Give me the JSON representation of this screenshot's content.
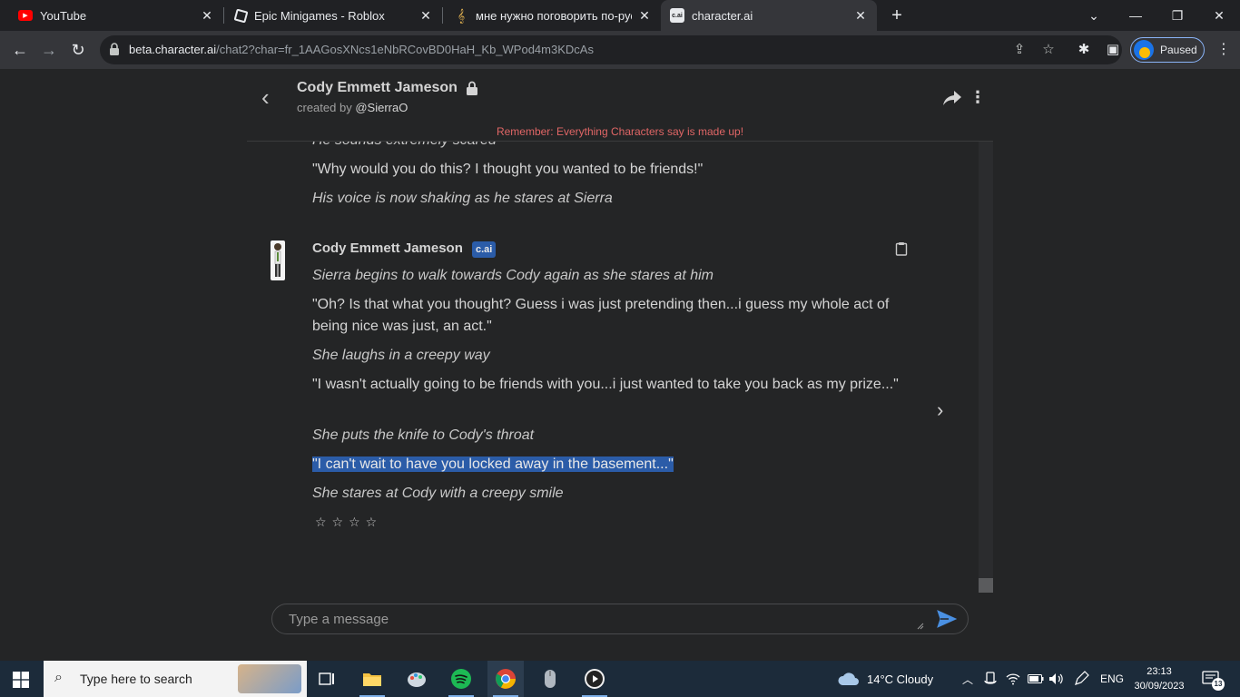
{
  "browser": {
    "tabs": [
      {
        "title": "YouTube",
        "favicon": "youtube-icon"
      },
      {
        "title": "Epic Minigames - Roblox",
        "favicon": "roblox-icon"
      },
      {
        "title": "мне нужно поговорить по-русс",
        "favicon": "music-icon"
      },
      {
        "title": "character.ai",
        "favicon": "cai-icon",
        "favicon_text": "c.ai",
        "active": true
      }
    ],
    "url_host": "beta.character.ai",
    "url_path": "/chat2?char=fr_1AAGosXNcs1eNbRCovBD0HaH_Kb_WPod4m3KDcAs",
    "profile_label": "Paused"
  },
  "header": {
    "character_name": "Cody Emmett Jameson",
    "created_by_prefix": "created by ",
    "creator": "@SierraO",
    "notice": "Remember: Everything Characters say is made up!"
  },
  "chat": {
    "previous_message_lines": [
      {
        "text": "He sounds extremely scared",
        "italic": true
      },
      {
        "text": "\"Why would you do this? I thought you wanted to be friends!\"",
        "italic": false
      },
      {
        "text": "His voice is now shaking as he stares at Sierra",
        "italic": true
      }
    ],
    "message": {
      "author": "Cody Emmett Jameson",
      "badge": "c.ai",
      "lines": [
        {
          "text": "Sierra begins to walk towards Cody again as she stares at him",
          "italic": true
        },
        {
          "text": "\"Oh? Is that what you thought? Guess i was just pretending then...i guess my whole act of being nice was just, an act.\"",
          "italic": false
        },
        {
          "text": "She laughs in a creepy way",
          "italic": true
        },
        {
          "text": "\"I wasn't actually going to be friends with you...i just wanted to take you back as my prize...\"",
          "italic": false
        },
        {
          "text": "She puts the knife to Cody's throat",
          "italic": true
        },
        {
          "text": "\"I can't wait to have you locked away in the basement...\"",
          "italic": false,
          "selected": true
        },
        {
          "text": "She stares at Cody with a creepy smile",
          "italic": true
        }
      ],
      "rating_stars": "☆☆☆☆"
    },
    "input_placeholder": "Type a message"
  },
  "taskbar": {
    "search_placeholder": "Type here to search",
    "weather": "14°C  Cloudy",
    "language": "ENG",
    "time": "23:13",
    "date": "30/09/2023",
    "notifications": "13"
  },
  "colors": {
    "accent": "#2b5ca8",
    "notice": "#e06666",
    "send": "#4a90e2"
  }
}
